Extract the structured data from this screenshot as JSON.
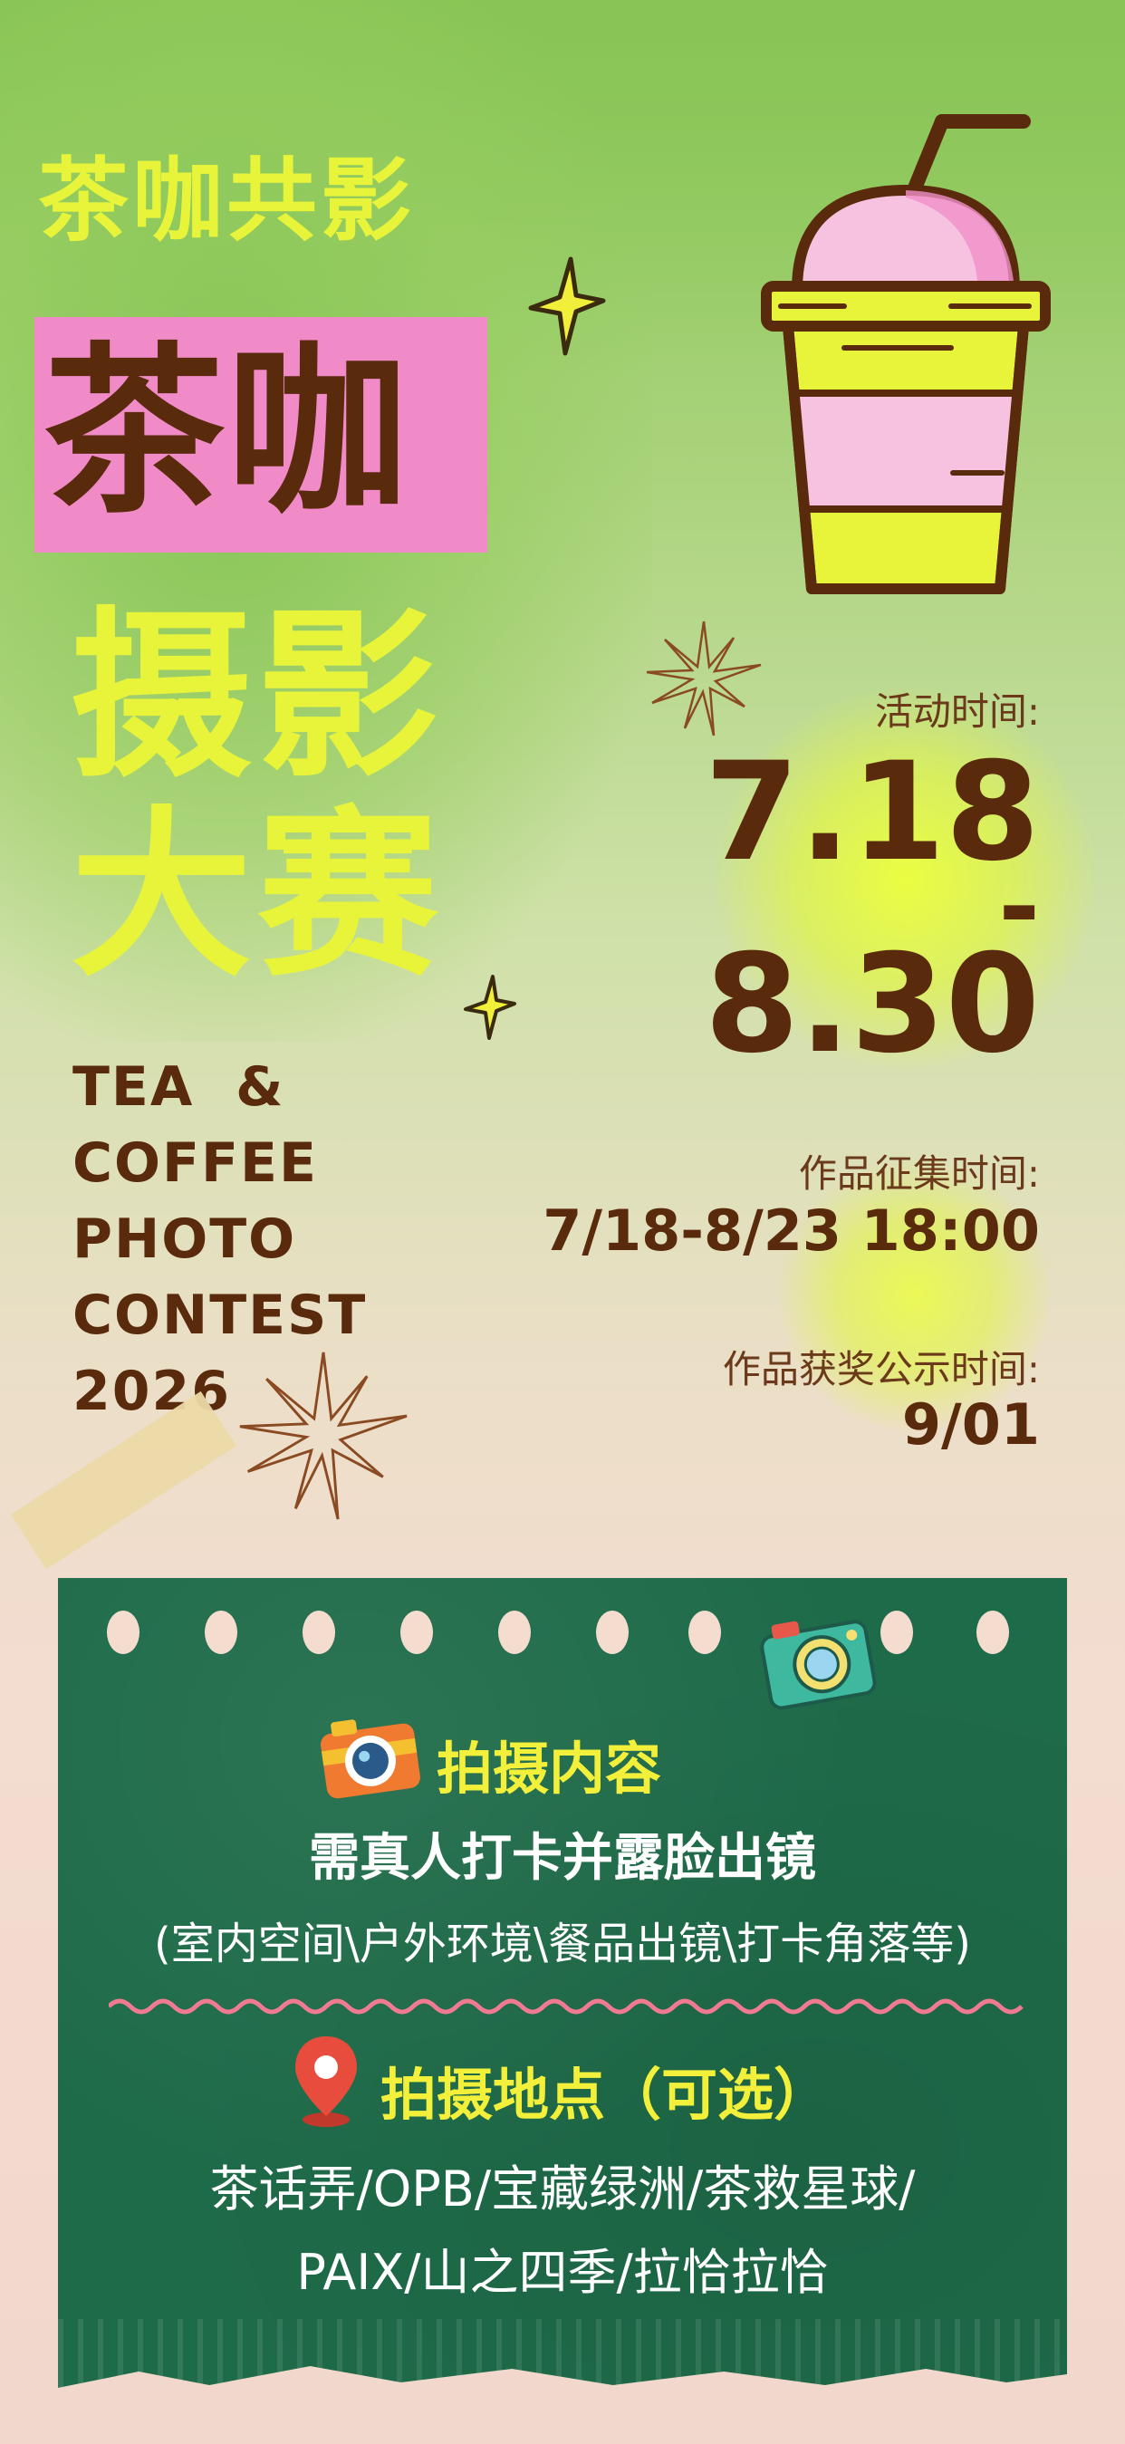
{
  "header": {
    "line1": "茶咖共影",
    "line2": "茶咖",
    "line3": "摄影",
    "line4": "大赛"
  },
  "english_title": {
    "lines": [
      "TEA  &",
      "COFFEE",
      "PHOTO",
      "CONTEST",
      "2026"
    ]
  },
  "schedule": {
    "activity_label": "活动时间:",
    "activity_start": "7.18",
    "activity_dash": "-",
    "activity_end": "8.30",
    "collection_label": "作品征集时间:",
    "collection_value": "7/18-8/23 18:00",
    "award_label": "作品获奖公示时间:",
    "award_value": "9/01"
  },
  "panel": {
    "section1_title": "拍摄内容",
    "section1_line1": "需真人打卡并露脸出镜",
    "section1_line2": "(室内空间\\户外环境\\餐品出镜\\打卡角落等)",
    "section2_title": "拍摄地点（可选）",
    "section2_line1": "茶话弄/OPB/宝藏绿洲/茶救星球/",
    "section2_line2": "PAIX/山之四季/拉恰拉恰"
  },
  "colors": {
    "brown": "#5a2a0c",
    "yellow": "#e8f43a",
    "pink": "#f08bc8",
    "panel_green": "#1e6b49"
  }
}
